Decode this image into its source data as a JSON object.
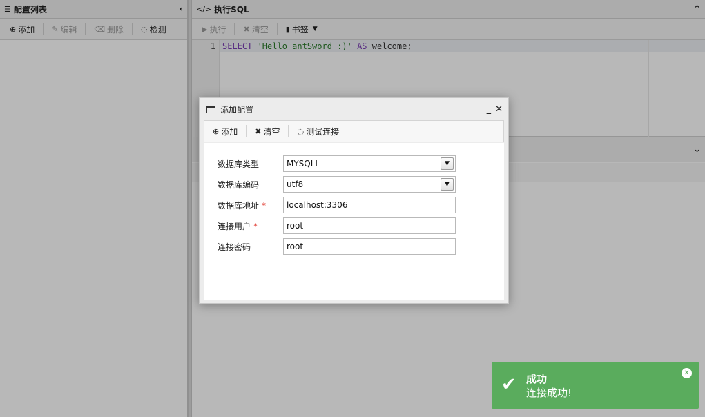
{
  "left_panel": {
    "title": "配置列表",
    "title_icon": "list-icon",
    "collapse_glyph": "‹",
    "toolbar": [
      {
        "label": "添加",
        "icon": "plus-circle-icon",
        "glyph": "⊕",
        "disabled": false
      },
      {
        "label": "编辑",
        "icon": "edit-icon",
        "glyph": "✎",
        "disabled": true
      },
      {
        "label": "删除",
        "icon": "trash-icon",
        "glyph": "🗑",
        "disabled": true
      },
      {
        "label": "检测",
        "icon": "spinner-icon",
        "glyph": "◌",
        "disabled": false
      }
    ]
  },
  "sql_panel": {
    "title": "执行SQL",
    "title_icon": "code-icon",
    "title_glyph": "</>",
    "collapse_glyph": "⌃",
    "toolbar": {
      "run_label": "执行",
      "clear_label": "清空",
      "bookmark_label": "书签"
    },
    "editor": {
      "line_number": "1",
      "tokens": [
        {
          "t": "kw",
          "v": "SELECT "
        },
        {
          "t": "str",
          "v": "'Hello antSword :)'"
        },
        {
          "t": "kw",
          "v": " AS "
        },
        {
          "t": "plain",
          "v": "welcome;"
        }
      ]
    },
    "lower_collapse_glyph": "⌄"
  },
  "dialog": {
    "title": "添加配置",
    "minimize_glyph": "_",
    "close_glyph": "✕",
    "toolbar": {
      "add_label": "添加",
      "clear_label": "清空",
      "test_label": "测试连接"
    },
    "fields": {
      "db_type_label": "数据库类型",
      "db_type_value": "MYSQLI",
      "db_encoding_label": "数据库编码",
      "db_encoding_value": "utf8",
      "db_host_label": "数据库地址",
      "db_host_value": "localhost:3306",
      "user_label": "连接用户",
      "user_value": "root",
      "password_label": "连接密码",
      "password_value": "root",
      "required_mark": "*"
    }
  },
  "toast": {
    "title": "成功",
    "message": "连接成功!",
    "color": "#5aac5d"
  }
}
